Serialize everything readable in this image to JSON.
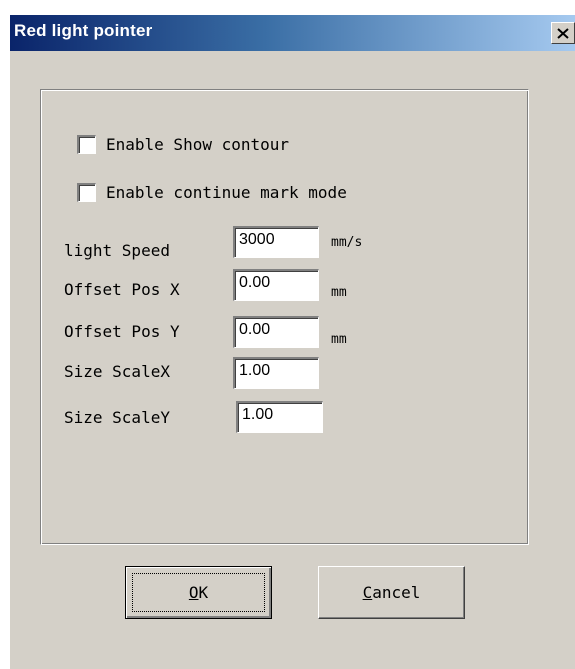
{
  "window": {
    "title": "Red light pointer",
    "close_icon": "close-icon"
  },
  "options": {
    "show_contour": {
      "label": "Enable Show contour",
      "checked": false
    },
    "continue_mark": {
      "label": "Enable continue mark mode",
      "checked": false
    }
  },
  "fields": {
    "light_speed": {
      "label": "light Speed",
      "value": "3000",
      "unit": "mm/s"
    },
    "offset_x": {
      "label": "Offset Pos X",
      "value": "0.00",
      "unit": "mm"
    },
    "offset_y": {
      "label": "Offset Pos Y",
      "value": "0.00",
      "unit": "mm"
    },
    "scale_x": {
      "label": "Size ScaleX",
      "value": "1.00"
    },
    "scale_y": {
      "label": "Size ScaleY",
      "value": "1.00"
    }
  },
  "buttons": {
    "ok": "OK",
    "cancel": "Cancel"
  },
  "colors": {
    "titlebar_start": "#0a246a",
    "titlebar_end": "#a6caf0",
    "face": "#d4d0c8"
  }
}
